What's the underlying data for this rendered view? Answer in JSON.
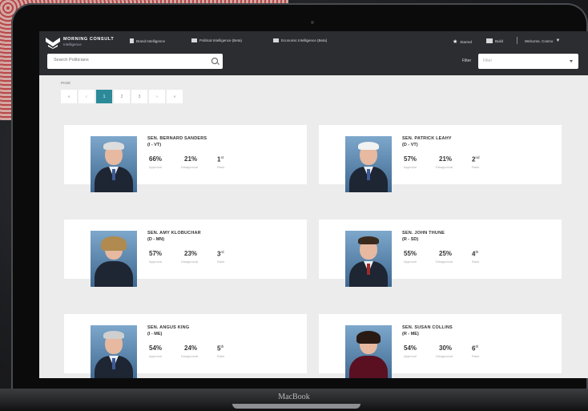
{
  "nav": {
    "brand_name": "MORNING CONSULT",
    "brand_sub": "Intelligence",
    "links": [
      {
        "label": "Brand Intelligence"
      },
      {
        "label": "Political Intelligence (Beta)"
      },
      {
        "label": "Economic Intelligence (Beta)"
      }
    ],
    "starred": "Starred",
    "build": "Build",
    "welcome": "Welcome, Cosmo"
  },
  "search": {
    "placeholder": "Search Politicians"
  },
  "filter": {
    "label": "Filter",
    "placeholder": "Filter"
  },
  "pagination": {
    "label": "PAGE",
    "buttons": [
      "«",
      "‹",
      "1",
      "2",
      "3",
      "›",
      "»"
    ],
    "active": "1"
  },
  "stat_labels": {
    "approval": "Approval",
    "disapproval": "Disapproval",
    "rank": "Rank"
  },
  "senators": [
    {
      "name": "SEN. BERNARD SANDERS",
      "party": "(I - VT)",
      "approval": "66%",
      "disapproval": "21%",
      "rank": "1",
      "rank_suffix": "st"
    },
    {
      "name": "SEN. PATRICK LEAHY",
      "party": "(D - VT)",
      "approval": "57%",
      "disapproval": "21%",
      "rank": "2",
      "rank_suffix": "nd"
    },
    {
      "name": "SEN. AMY KLOBUCHAR",
      "party": "(D - MN)",
      "approval": "57%",
      "disapproval": "23%",
      "rank": "3",
      "rank_suffix": "rd"
    },
    {
      "name": "SEN. JOHN THUNE",
      "party": "(R - SD)",
      "approval": "55%",
      "disapproval": "25%",
      "rank": "4",
      "rank_suffix": "th"
    },
    {
      "name": "SEN. ANGUS KING",
      "party": "(I - ME)",
      "approval": "54%",
      "disapproval": "24%",
      "rank": "5",
      "rank_suffix": "th"
    },
    {
      "name": "SEN. SUSAN COLLINS",
      "party": "(R - ME)",
      "approval": "54%",
      "disapproval": "30%",
      "rank": "6",
      "rank_suffix": "th"
    }
  ],
  "device_label": "MacBook",
  "colors": {
    "accent": "#2c8a98",
    "navbar": "#2b2d31"
  }
}
